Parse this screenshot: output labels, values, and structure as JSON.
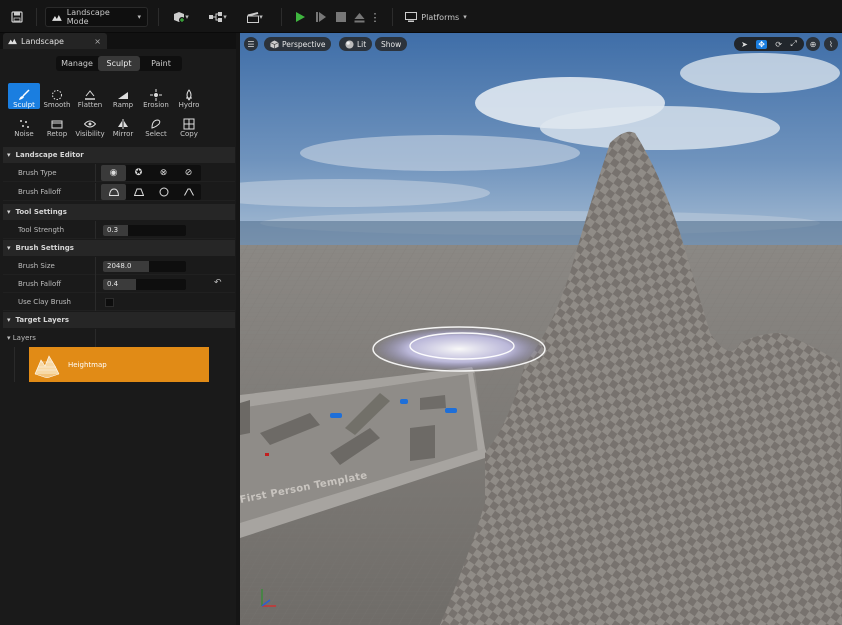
{
  "toolbar": {
    "mode_label": "Landscape Mode",
    "platforms_label": "Platforms"
  },
  "panel": {
    "tab_title": "Landscape",
    "tab_close": "×",
    "modes": [
      "Manage",
      "Sculpt",
      "Paint"
    ],
    "active_mode": "Sculpt",
    "tools_row1": [
      {
        "label": "Sculpt",
        "icon": "brush-icon",
        "selected": true
      },
      {
        "label": "Smooth",
        "icon": "smooth-icon"
      },
      {
        "label": "Flatten",
        "icon": "flatten-icon"
      },
      {
        "label": "Ramp",
        "icon": "ramp-icon"
      },
      {
        "label": "Erosion",
        "icon": "erosion-icon"
      },
      {
        "label": "Hydro",
        "icon": "hydro-icon"
      }
    ],
    "tools_row2": [
      {
        "label": "Noise",
        "icon": "noise-icon"
      },
      {
        "label": "Retop",
        "icon": "retop-icon"
      },
      {
        "label": "Visibility",
        "icon": "visibility-icon"
      },
      {
        "label": "Mirror",
        "icon": "mirror-icon"
      },
      {
        "label": "Select",
        "icon": "select-icon"
      },
      {
        "label": "Copy",
        "icon": "copy-icon"
      }
    ],
    "sections": {
      "landscape_editor": "Landscape Editor",
      "tool_settings": "Tool Settings",
      "brush_settings": "Brush Settings",
      "target_layers": "Target Layers"
    },
    "rows": {
      "brush_type": "Brush Type",
      "brush_falloff_1": "Brush Falloff",
      "tool_strength": "Tool Strength",
      "tool_strength_value": "0.3",
      "tool_strength_fraction": 0.3,
      "brush_size": "Brush Size",
      "brush_size_value": "2048.0",
      "brush_size_fraction": 0.55,
      "brush_falloff_2": "Brush Falloff",
      "brush_falloff_value": "0.4",
      "brush_falloff_fraction": 0.4,
      "use_clay_brush": "Use Clay Brush",
      "use_clay_brush_checked": false,
      "layers": "Layers"
    },
    "layer_item": "Heightmap"
  },
  "viewport": {
    "perspective_label": "Perspective",
    "lit_label": "Lit",
    "show_label": "Show",
    "floor_text": "First Person Template"
  },
  "colors": {
    "accent": "#1a7ee0",
    "layer_highlight": "#e18b16",
    "play_green": "#3fb63f"
  }
}
